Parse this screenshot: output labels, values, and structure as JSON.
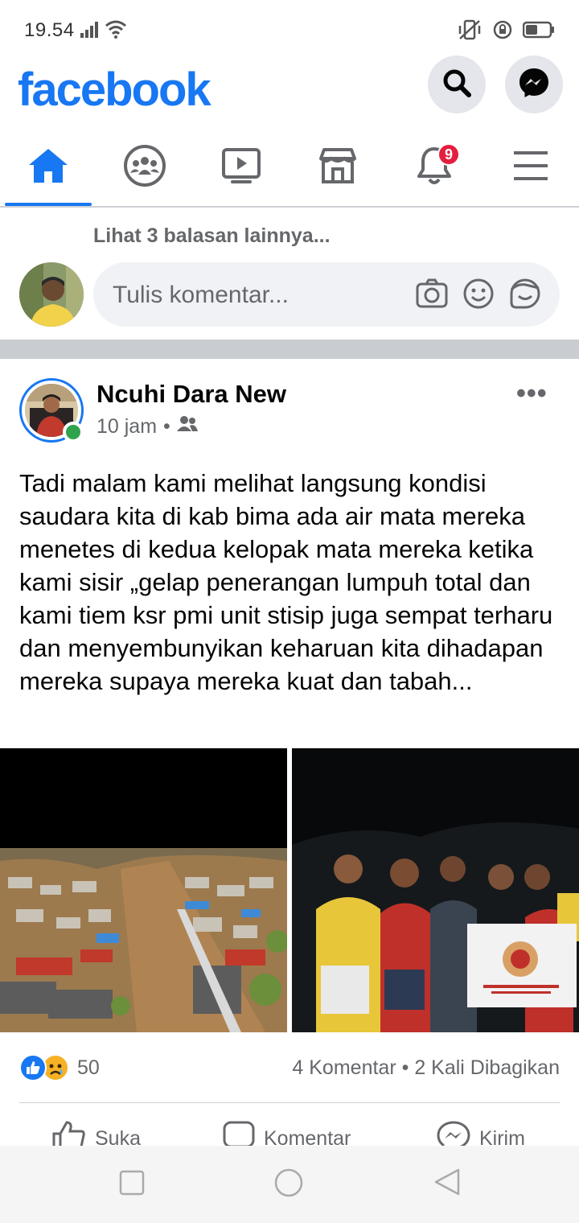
{
  "status_bar": {
    "time": "19.54",
    "icons": [
      "signal-icon",
      "wifi-icon",
      "vibrate-icon",
      "rotation-lock-icon",
      "battery-icon"
    ]
  },
  "header": {
    "logo": "facebook",
    "brand_color": "#1877f2",
    "buttons": [
      "search-icon",
      "messenger-icon"
    ]
  },
  "nav": {
    "tabs": [
      {
        "name": "home-icon",
        "active": true
      },
      {
        "name": "groups-icon",
        "active": false
      },
      {
        "name": "watch-icon",
        "active": false
      },
      {
        "name": "marketplace-icon",
        "active": false
      },
      {
        "name": "notifications-icon",
        "active": false,
        "badge": "9"
      },
      {
        "name": "menu-icon",
        "active": false
      }
    ]
  },
  "comments": {
    "more_replies": "Lihat 3 balasan lainnya...",
    "placeholder": "Tulis komentar...",
    "input_icons": [
      "camera-icon",
      "emoji-icon",
      "sticker-icon"
    ]
  },
  "post": {
    "author": "Ncuhi Dara New",
    "time": "10 jam",
    "separator": "•",
    "text": "Tadi malam kami melihat langsung kondisi saudara kita di kab bima ada air mata mereka menetes di kedua kelopak mata mereka ketika kami sisir „gelap penerangan lumpuh total  dan kami tiem ksr pmi unit stisip  juga sempat terharu dan menyembunyikan keharuan kita dihadapan mereka supaya mereka kuat dan tabah...",
    "reaction_count": "50",
    "comments_count": "4 Komentar",
    "shares_count": "2 Kali Dibagikan",
    "stats_separator": "•",
    "actions": {
      "like": "Suka",
      "comment": "Komentar",
      "send": "Kirim"
    }
  }
}
